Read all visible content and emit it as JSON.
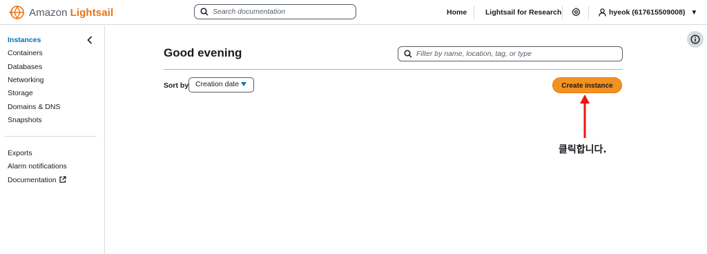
{
  "header": {
    "brand_prefix": "Amazon",
    "brand_name": "Lightsail",
    "search_placeholder": "Search documentation",
    "nav": [
      "Home",
      "Lightsail for Research"
    ],
    "user": "hyeok (617615509008)",
    "icons": [
      "lightsail-logo-icon",
      "search-icon",
      "gear-icon",
      "user-icon",
      "caret-down-icon"
    ]
  },
  "sidebar": {
    "items": [
      "Instances",
      "Containers",
      "Databases",
      "Networking",
      "Storage",
      "Domains & DNS",
      "Snapshots"
    ],
    "secondary": [
      "Exports",
      "Alarm notifications",
      "Documentation"
    ],
    "active": "Instances"
  },
  "main": {
    "greeting": "Good evening",
    "filter_placeholder": "Filter by name, location, tag, or type",
    "sort_label": "Sort by",
    "sort_value": "Creation date",
    "create_button": "Create instance"
  },
  "annotation": {
    "text": "클릭합니다.",
    "arrow_color": "#e8160c"
  },
  "colors": {
    "accent": "#ec7211",
    "button": "#f39221",
    "link": "#0073bb"
  }
}
